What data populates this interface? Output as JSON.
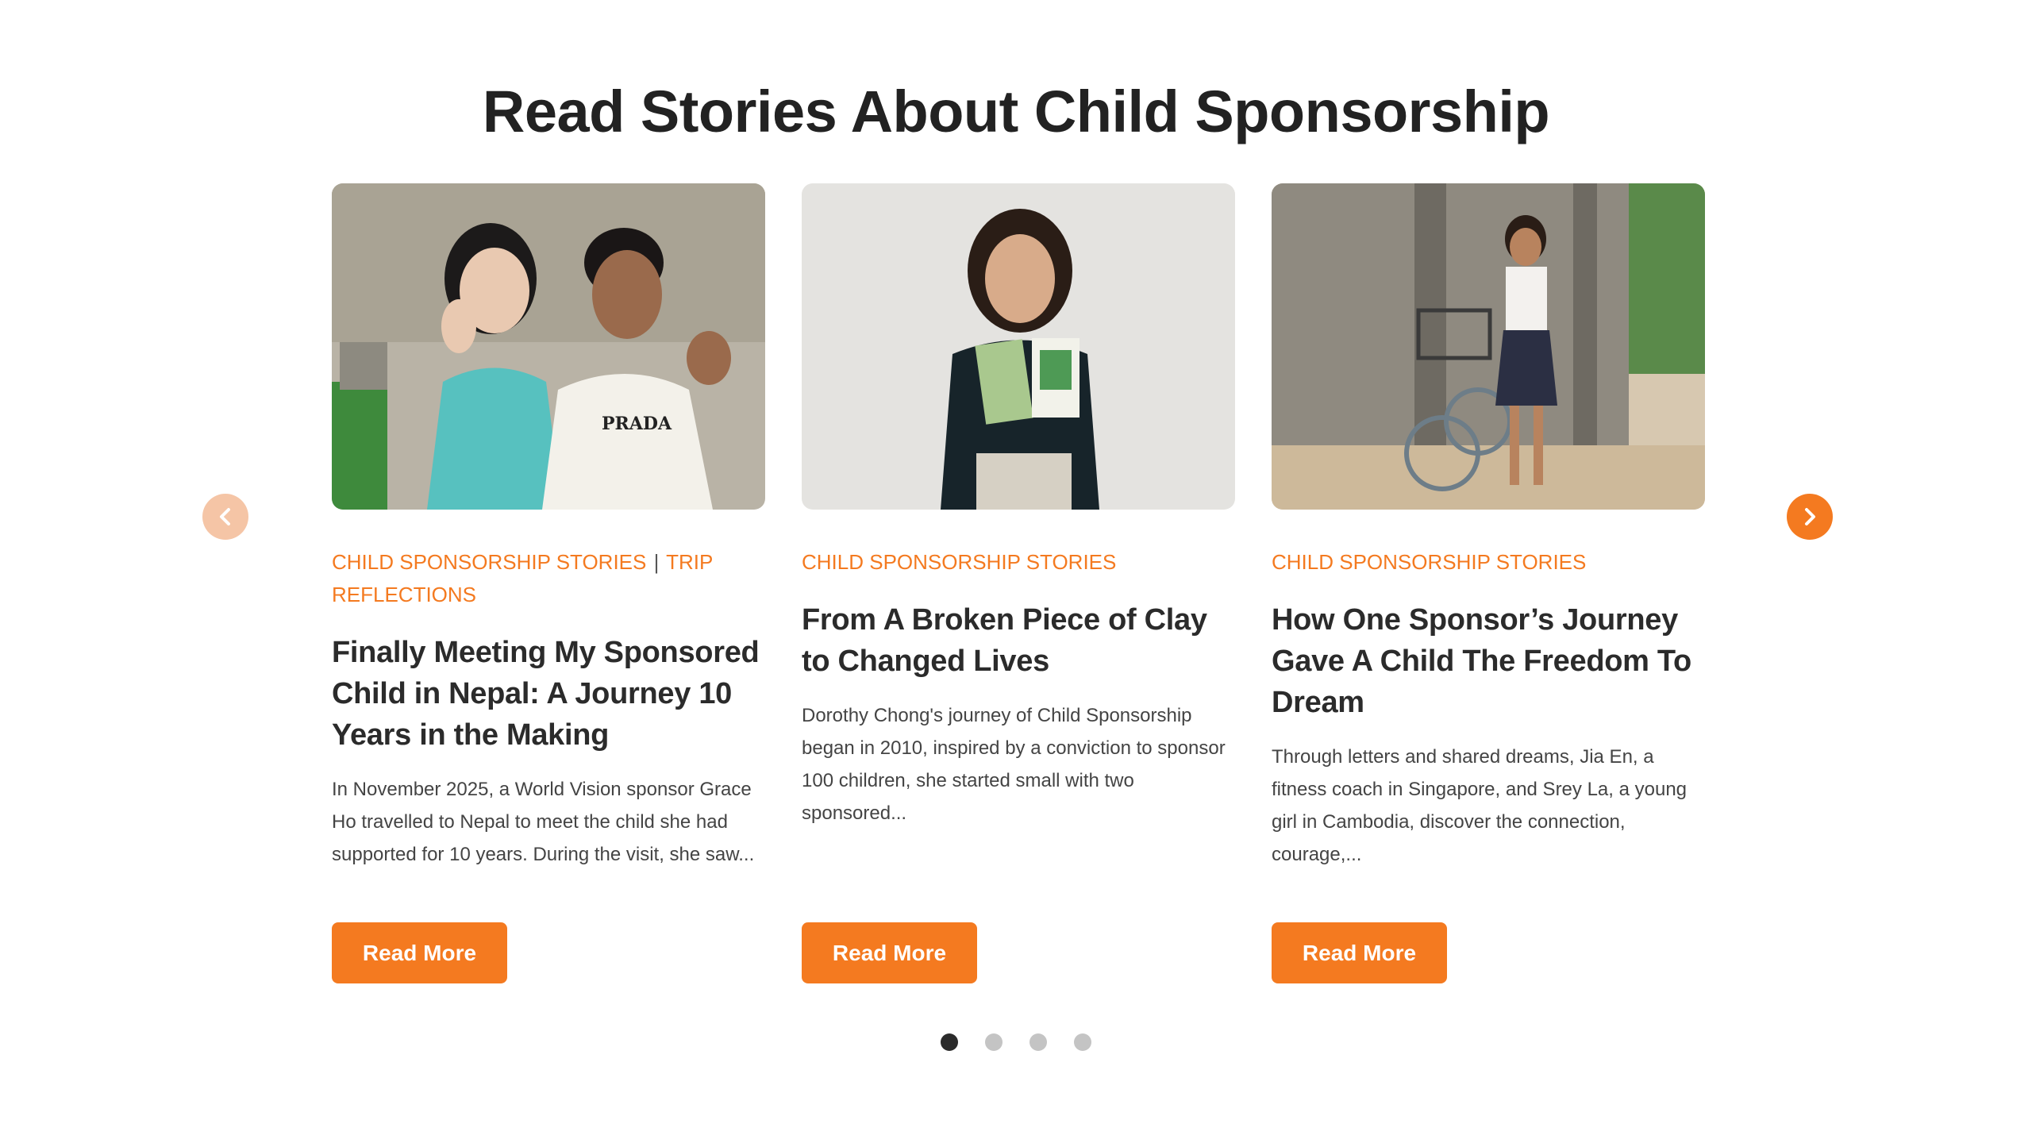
{
  "section": {
    "title": "Read Stories About Child Sponsorship"
  },
  "carousel": {
    "prev_icon": "chevron-left-icon",
    "next_icon": "chevron-right-icon",
    "accent_color": "#f47a20",
    "accent_light_color": "#f5c5a6",
    "cards": [
      {
        "category_1": "CHILD SPONSORSHIP STORIES",
        "separator": "|",
        "category_2": "TRIP REFLECTIONS",
        "title": "Finally Meeting My Sponsored Child in Nepal: A Journey 10 Years in the Making",
        "excerpt": "In November 2025, a World Vision sponsor Grace Ho travelled to Nepal to meet the child she had supported for 10 years. During the visit, she saw...",
        "button": "Read More",
        "image_alt": "Sponsor and young man waving"
      },
      {
        "category_1": "CHILD SPONSORSHIP STORIES",
        "title": "From A Broken Piece of Clay to Changed Lives",
        "excerpt": "Dorothy Chong's journey of Child Sponsorship began in 2010, inspired by a conviction to sponsor 100 children, she started small with two sponsored...",
        "button": "Read More",
        "image_alt": "Woman holding child photo cards"
      },
      {
        "category_1": "CHILD SPONSORSHIP STORIES",
        "title": "How One Sponsor’s Journey Gave A Child The Freedom To Dream",
        "excerpt": "Through letters and shared dreams, Jia En, a fitness coach in Singapore, and Srey La, a young girl in Cambodia, discover the connection, courage,...",
        "button": "Read More",
        "image_alt": "Girl standing with bicycle"
      }
    ],
    "dots_count": 4,
    "active_dot": 1
  }
}
